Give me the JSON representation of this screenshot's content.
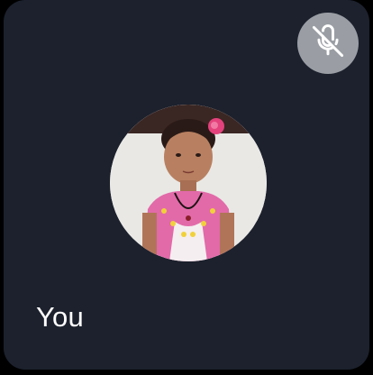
{
  "participant": {
    "name": "You",
    "mic_state": "muted",
    "mic_icon": "mic-off-icon",
    "avatar": "avatar-photo"
  },
  "colors": {
    "tile_background": "#1c212d",
    "mute_button_background": "#9a9ea4",
    "name_text": "#ffffff"
  }
}
